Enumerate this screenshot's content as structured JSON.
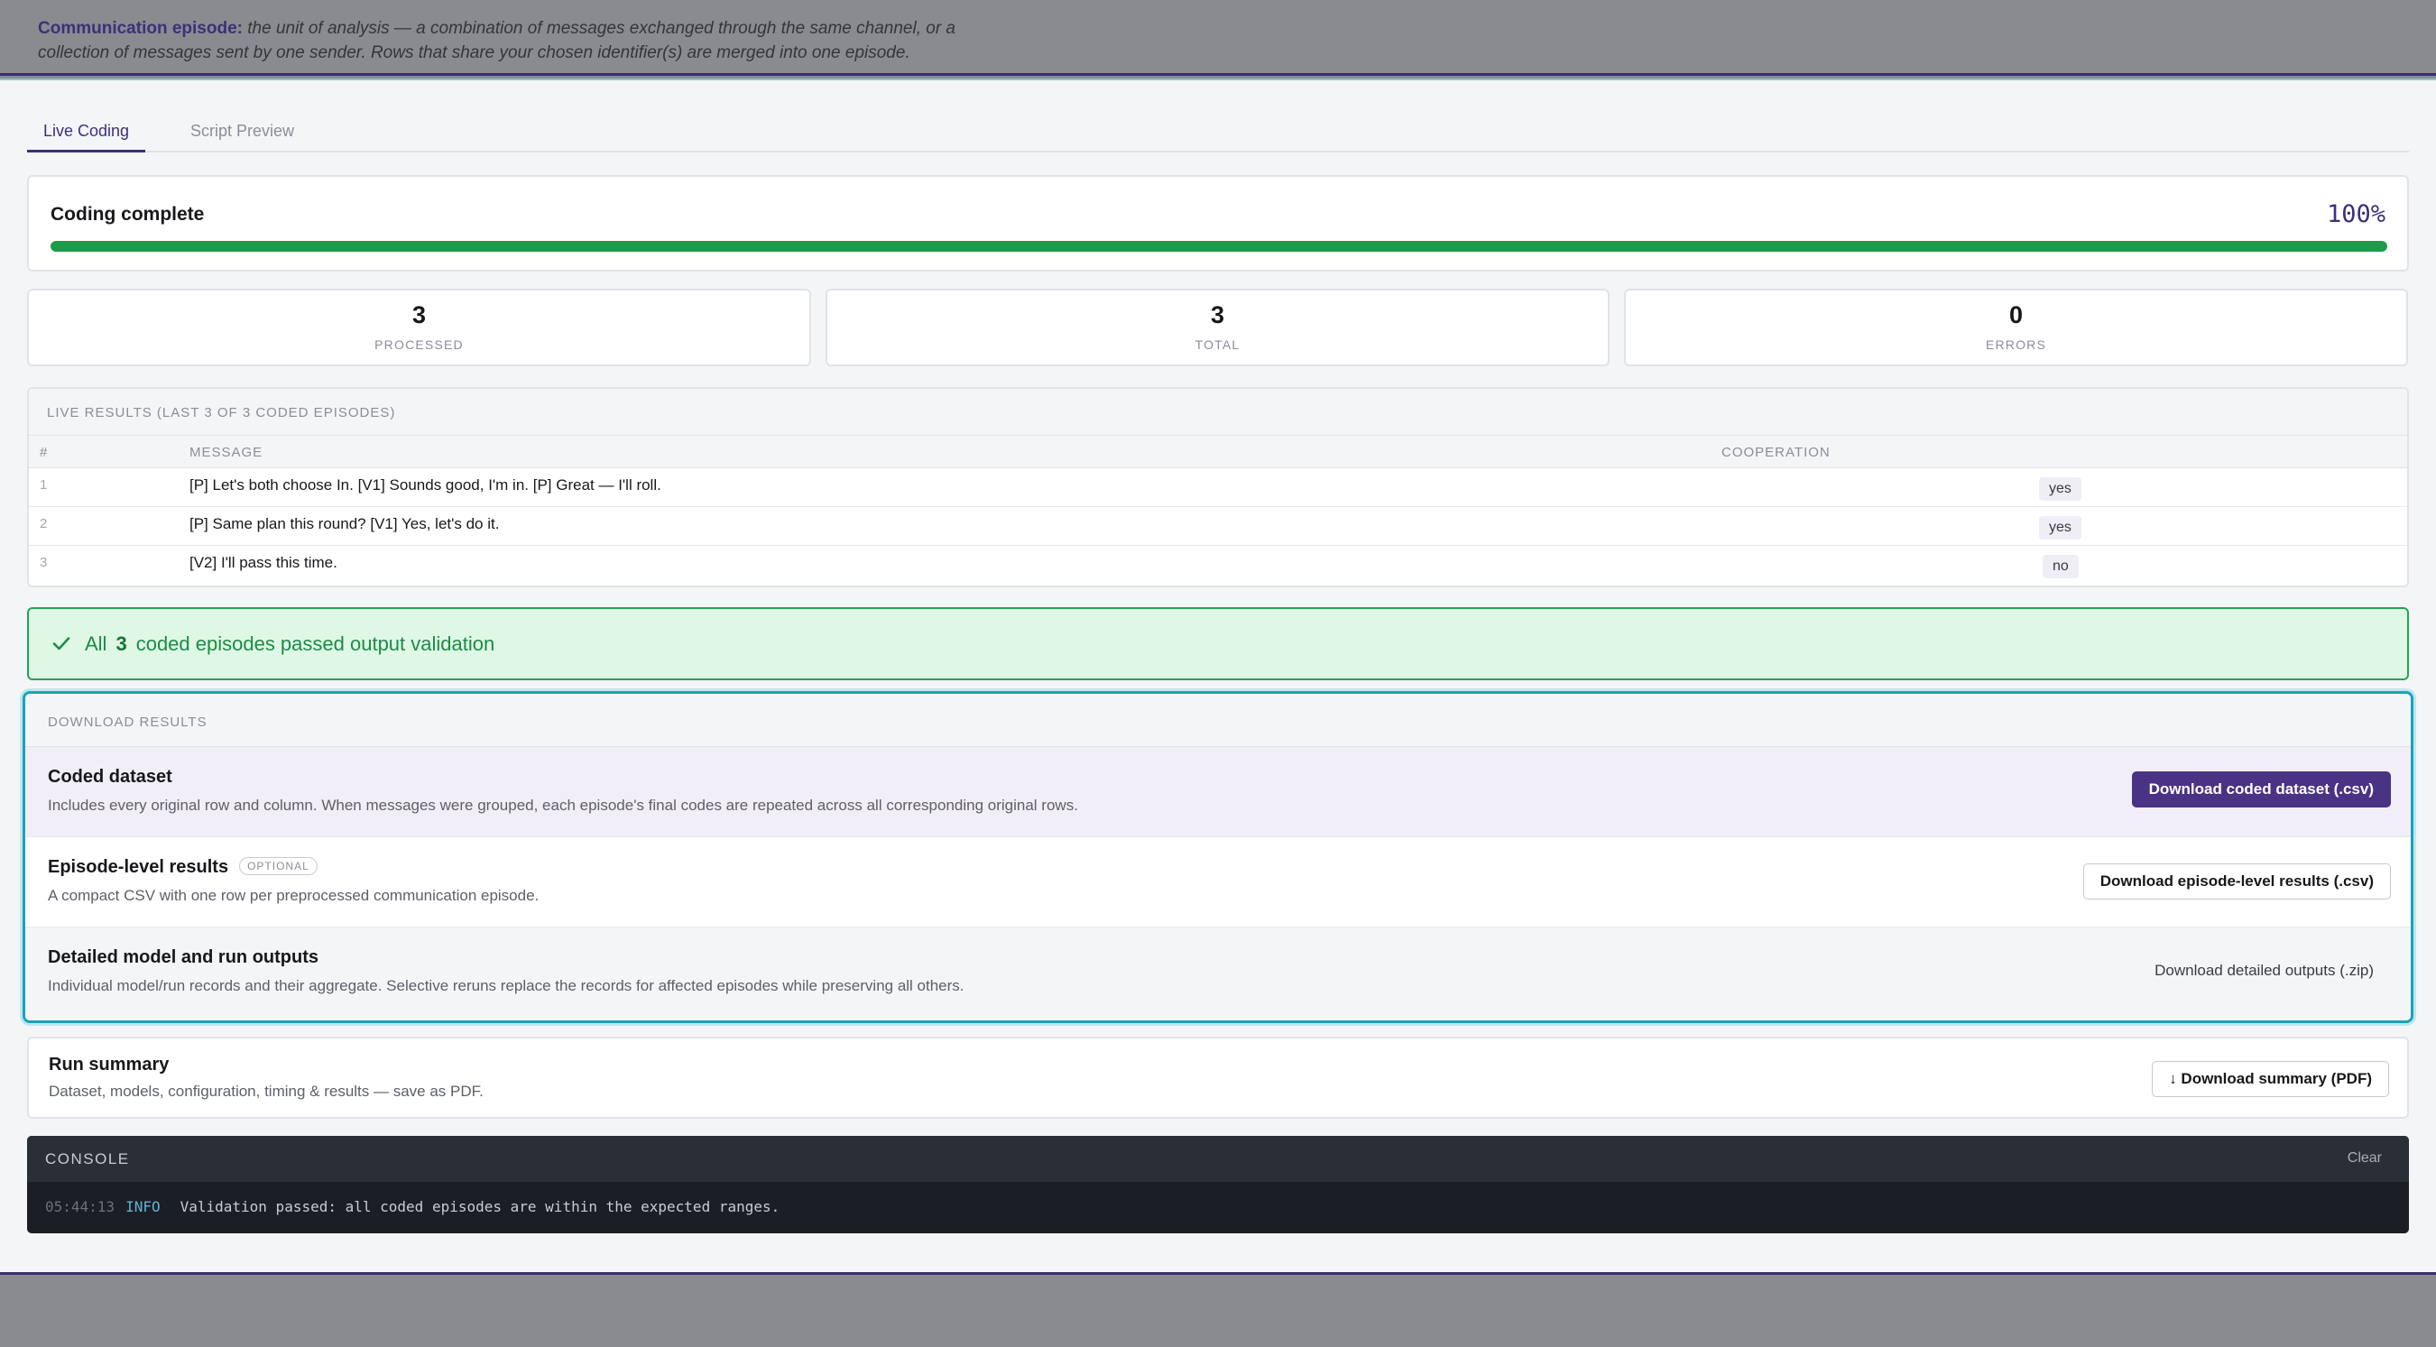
{
  "header": {
    "definition_term": "Communication episode:",
    "definition_text": "the unit of analysis — a combination of messages exchanged through the same channel, or a collection of messages sent by one sender. Rows that share your chosen identifier(s) are merged into one episode."
  },
  "tabs": [
    {
      "label": "Live Coding"
    },
    {
      "label": "Script Preview"
    }
  ],
  "progress": {
    "title": "Coding complete",
    "percent_label": "100%",
    "fraction": 1.0,
    "color": "#1f9a4a"
  },
  "stats": [
    {
      "value": "3",
      "label": "PROCESSED"
    },
    {
      "value": "3",
      "label": "TOTAL"
    },
    {
      "value": "0",
      "label": "ERRORS"
    }
  ],
  "live_results": {
    "title": "LIVE RESULTS (LAST 3 OF 3 CODED EPISODES)",
    "columns": [
      "#",
      "MESSAGE",
      "COOPERATION"
    ],
    "rows": [
      {
        "index": "1",
        "message": "[P] Let's both choose In. [V1] Sounds good, I'm in. [P] Great — I'll roll.",
        "cooperation": "yes"
      },
      {
        "index": "2",
        "message": "[P] Same plan this round? [V1] Yes, let's do it.",
        "cooperation": "yes"
      },
      {
        "index": "3",
        "message": "[V2] I'll pass this time.",
        "cooperation": "no"
      }
    ]
  },
  "validation": {
    "prefix": "All",
    "count": "3",
    "suffix": "coded episodes passed output validation",
    "icon": "check-icon"
  },
  "downloads": {
    "title": "DOWNLOAD RESULTS",
    "items": [
      {
        "title": "Coded dataset",
        "badge": "",
        "description": "Includes every original row and column. When messages were grouped, each episode's final codes are repeated across all corresponding original rows.",
        "button": "Download coded dataset (.csv)"
      },
      {
        "title": "Episode-level results",
        "badge": "OPTIONAL",
        "description": "A compact CSV with one row per preprocessed communication episode.",
        "button": "Download episode-level results (.csv)"
      },
      {
        "title": "Detailed model and run outputs",
        "badge": "",
        "description": "Individual model/run records and their aggregate. Selective reruns replace the records for affected episodes while preserving all others.",
        "button": "Download detailed outputs (.zip)"
      }
    ]
  },
  "summary": {
    "title": "Run summary",
    "description": "Dataset, models, configuration, timing & results — save as PDF.",
    "button": "↓ Download summary (PDF)"
  },
  "console": {
    "label": "CONSOLE",
    "clear": "Clear",
    "lines": [
      {
        "time": "05:44:13",
        "level": "INFO",
        "text": "Validation passed: all coded episodes are within the expected ranges."
      }
    ]
  },
  "colors": {
    "brand": "#3e2f7a",
    "primary_button": "#4a3284",
    "success": "#1f9a4a",
    "accent_outline": "#18a3b9"
  }
}
